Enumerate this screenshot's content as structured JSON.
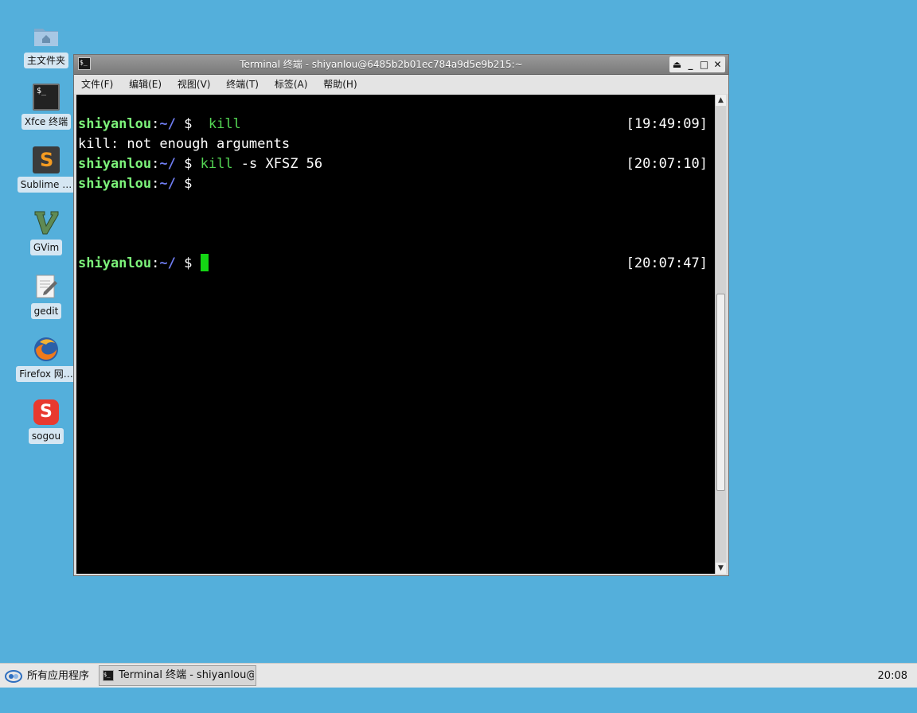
{
  "desktop": {
    "icons": [
      {
        "label": "主文件夹",
        "icon": "home-folder-icon"
      },
      {
        "label": "Xfce 终端",
        "icon": "terminal-icon",
        "glyph": "$_"
      },
      {
        "label": "Sublime …",
        "icon": "sublime-icon",
        "glyph": "S"
      },
      {
        "label": "GVim",
        "icon": "gvim-icon",
        "glyph": "V"
      },
      {
        "label": "gedit",
        "icon": "gedit-icon"
      },
      {
        "label": "Firefox 网…",
        "icon": "firefox-icon"
      },
      {
        "label": "sogou",
        "icon": "sogou-icon",
        "glyph": "S"
      }
    ]
  },
  "window": {
    "title": "Terminal 终端 - shiyanlou@6485b2b01ec784a9d5e9b215:~",
    "menu": [
      "文件(F)",
      "编辑(E)",
      "视图(V)",
      "终端(T)",
      "标签(A)",
      "帮助(H)"
    ],
    "buttons": {
      "shade": "⏏",
      "minimize": "_",
      "maximize": "□",
      "close": "✕"
    }
  },
  "terminal": {
    "user": "shiyanlou",
    "path": "~/",
    "prompt_symbol": "$",
    "lines": [
      {
        "type": "prompt",
        "cmd": " kill",
        "timestamp": "[19:49:09]"
      },
      {
        "type": "output",
        "text": "kill: not enough arguments"
      },
      {
        "type": "prompt",
        "cmd": "kill",
        "args": " -s XFSZ 56",
        "timestamp": "[20:07:10]"
      },
      {
        "type": "prompt",
        "cmd": ""
      },
      {
        "type": "prompt",
        "cmd": "",
        "cursor": true,
        "timestamp": "[20:07:47]"
      }
    ]
  },
  "taskbar": {
    "start_label": "所有应用程序",
    "task_label": "Terminal 终端 - shiyanlou@…",
    "clock": "20:08"
  },
  "colors": {
    "desktop_bg": "#54afdb",
    "prompt_user": "#7cf27a",
    "prompt_path": "#6f7cf0",
    "command": "#54d654",
    "cursor": "#14d614"
  }
}
